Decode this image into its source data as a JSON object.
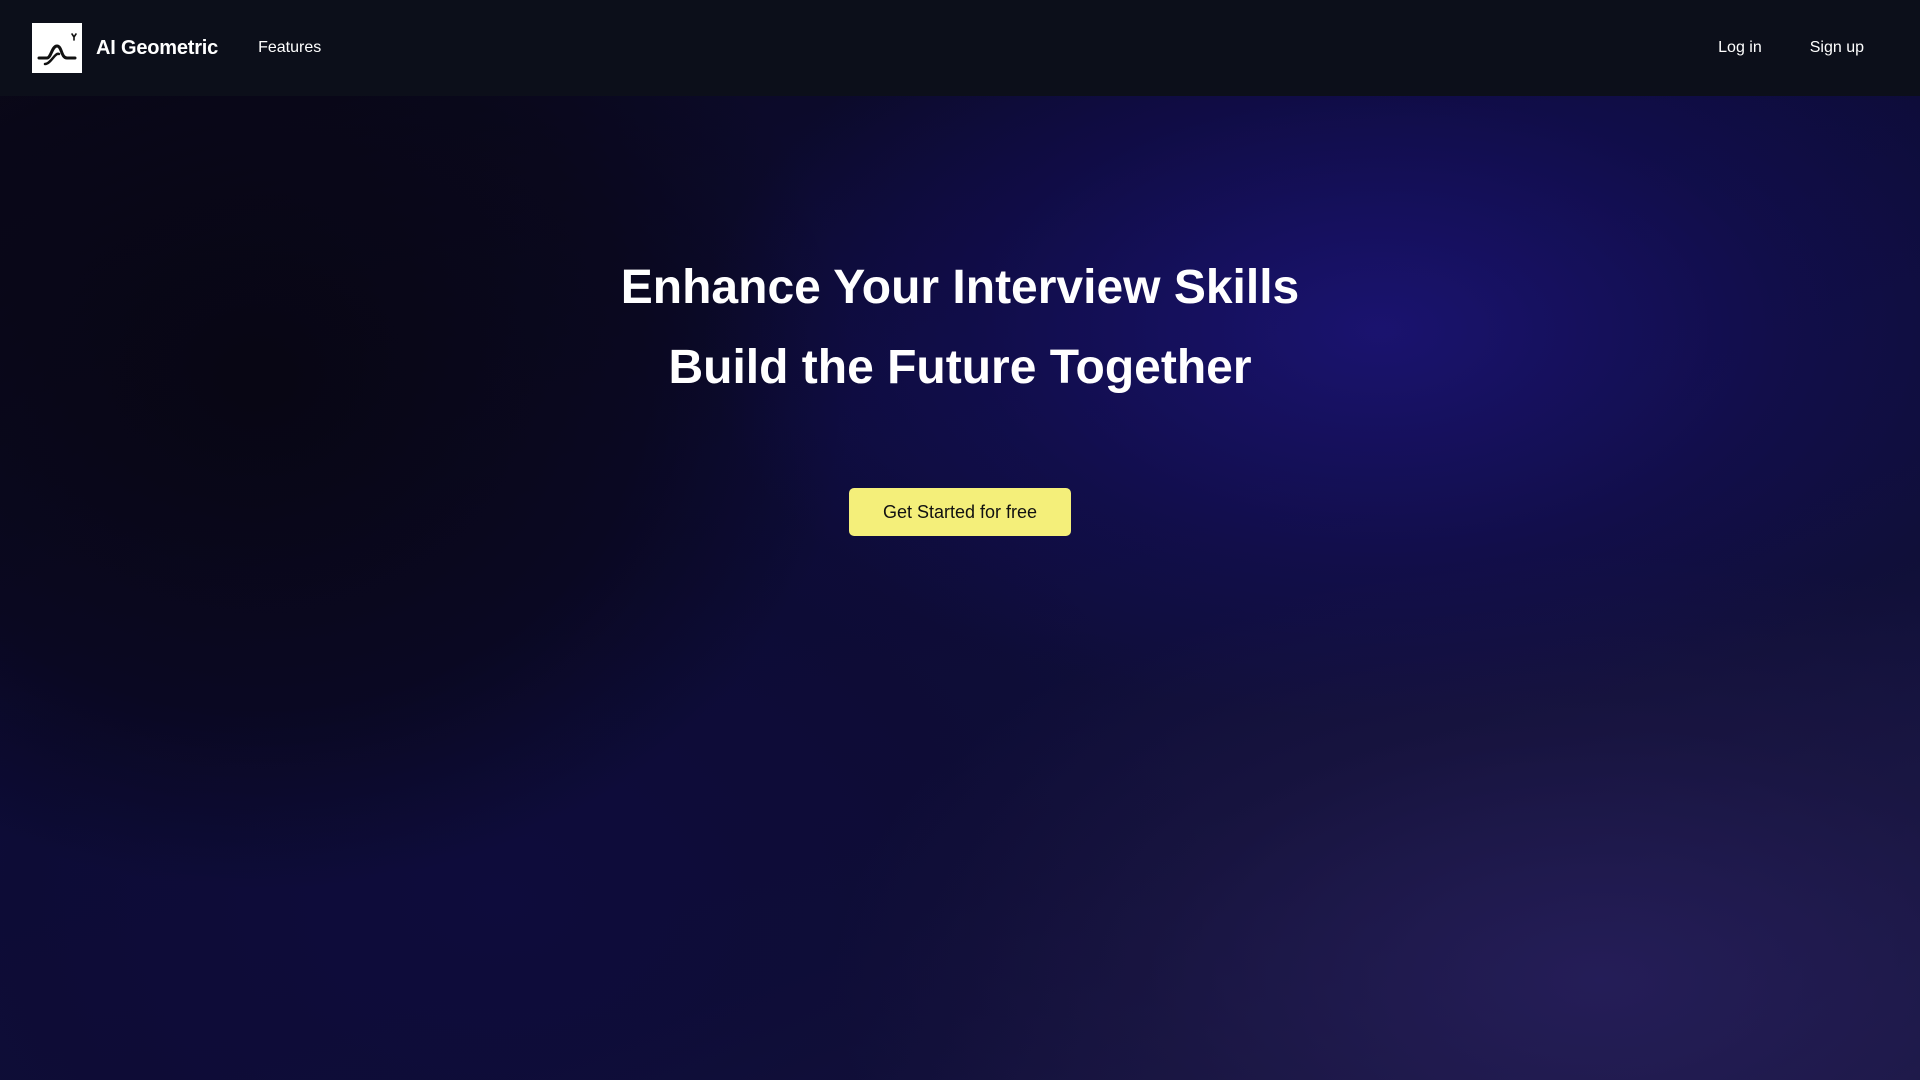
{
  "navbar": {
    "brand_name": "AI Geometric",
    "logo_icon": "wave-curve-logo-icon",
    "features_label": "Features",
    "login_label": "Log in",
    "signup_label": "Sign up"
  },
  "hero": {
    "headline_line1": "Enhance Your Interview Skills",
    "headline_line2": "Build the Future Together",
    "cta_label": "Get Started for free"
  },
  "colors": {
    "navbar_bg": "#0c0f1a",
    "cta_bg": "#f4ef7a",
    "cta_text": "#111111",
    "text": "#ffffff"
  }
}
